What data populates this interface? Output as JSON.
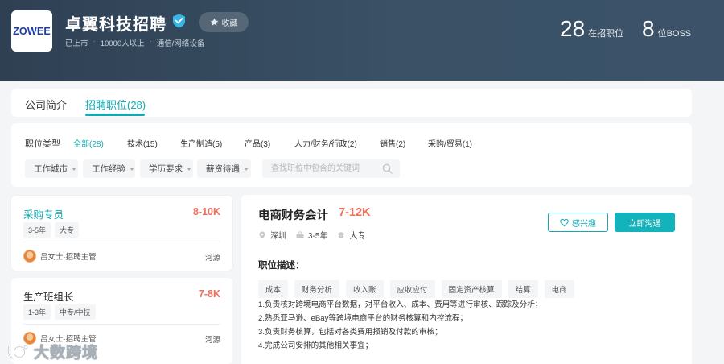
{
  "company": {
    "logo_text": "ZOWEE",
    "name": "卓翼科技招聘",
    "favorite_label": "收藏",
    "meta": [
      "已上市",
      "10000人以上",
      "通信/网络设备"
    ],
    "stats": [
      {
        "num": "28",
        "label": "在招职位"
      },
      {
        "num": "8",
        "label": "位BOSS"
      }
    ]
  },
  "tabs": [
    {
      "label": "公司简介",
      "active": false
    },
    {
      "label": "招聘职位(28)",
      "active": true
    }
  ],
  "filters": {
    "type_title": "职位类型",
    "categories": [
      {
        "label": "全部(28)",
        "active": true
      },
      {
        "label": "技术(15)"
      },
      {
        "label": "生产制造(5)"
      },
      {
        "label": "产品(3)"
      },
      {
        "label": "人力/财务/行政(2)"
      },
      {
        "label": "销售(2)"
      },
      {
        "label": "采购/贸易(1)"
      }
    ],
    "dropdowns": [
      "工作城市",
      "工作经验",
      "学历要求",
      "薪资待遇"
    ],
    "search_placeholder": "查找职位中包含的关键词"
  },
  "jobs": [
    {
      "title": "采购专员",
      "salary": "8-10K",
      "tags": [
        "3-5年",
        "大专"
      ],
      "recruiter": "吕女士·招聘主管",
      "source": "河源",
      "active": true
    },
    {
      "title": "生产班组长",
      "salary": "7-8K",
      "tags": [
        "1-3年",
        "中专/中技"
      ],
      "recruiter": "吕女士·招聘主管",
      "source": "河源",
      "active": false
    }
  ],
  "detail": {
    "title": "电商财务会计",
    "salary": "7-12K",
    "meta": {
      "city": "深圳",
      "experience": "3-5年",
      "education": "大专"
    },
    "interest_label": "感兴趣",
    "chat_label": "立即沟通",
    "section_title": "职位描述：",
    "tags": [
      "成本",
      "财务分析",
      "收入账",
      "应收应付",
      "固定资产核算",
      "结算",
      "电商"
    ],
    "lines": [
      "1.负责核对跨境电商平台数据，对平台收入、成本、费用等进行审核、跟踪及分析；",
      "2.熟悉亚马逊、eBay等跨境电商平台的财务核算和内控流程；",
      "3.负责财务核算，包括对各类费用报销及付款的审核；",
      "4.完成公司安排的其他相关事宜；"
    ]
  },
  "watermark": {
    "text": "大数跨境"
  },
  "colors": {
    "accent": "#13a9b3",
    "salary": "#f26d5b",
    "header": "#34485c"
  }
}
